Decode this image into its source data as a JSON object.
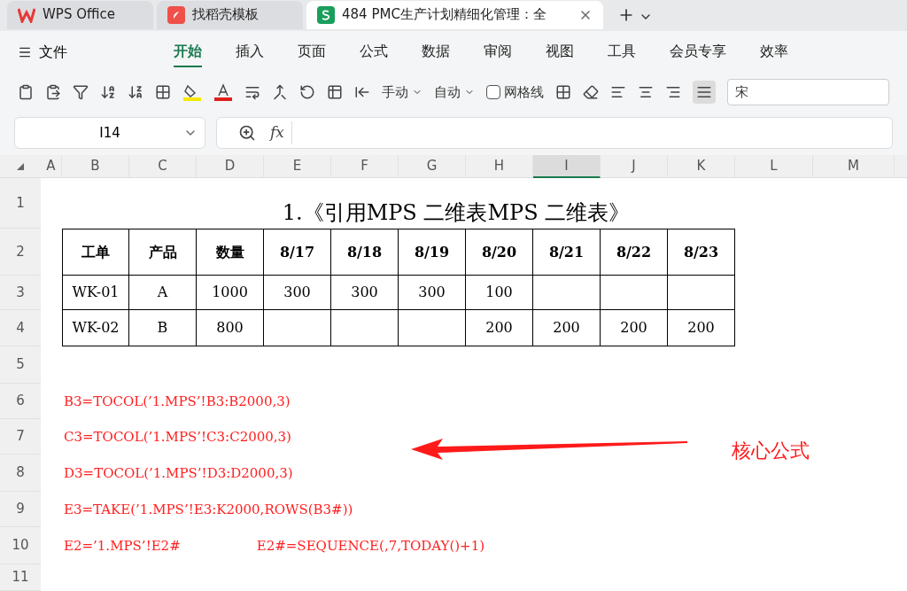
{
  "app_tabs": [
    {
      "label": "WPS Office",
      "kind": "wps",
      "selected": false
    },
    {
      "label": "找稻壳模板",
      "kind": "docer",
      "selected": false
    },
    {
      "label": "484 PMC生产计划精细化管理：全",
      "kind": "sheet",
      "selected": true
    }
  ],
  "file_menu": "文件",
  "ribbon_tabs": [
    {
      "label": "开始",
      "selected": true
    },
    {
      "label": "插入",
      "selected": false
    },
    {
      "label": "页面",
      "selected": false
    },
    {
      "label": "公式",
      "selected": false
    },
    {
      "label": "数据",
      "selected": false
    },
    {
      "label": "审阅",
      "selected": false
    },
    {
      "label": "视图",
      "selected": false
    },
    {
      "label": "工具",
      "selected": false
    },
    {
      "label": "会员专享",
      "selected": false
    },
    {
      "label": "效率",
      "selected": false
    }
  ],
  "toolbar": {
    "row_height": "手动",
    "col_width": "自动",
    "gridlines": {
      "label": "网格线",
      "checked": false
    },
    "font": "宋"
  },
  "name_box": "I14",
  "formula_label": "fx",
  "columns": [
    {
      "label": "A",
      "selected": false
    },
    {
      "label": "B",
      "selected": false
    },
    {
      "label": "C",
      "selected": false
    },
    {
      "label": "D",
      "selected": false
    },
    {
      "label": "E",
      "selected": false
    },
    {
      "label": "F",
      "selected": false
    },
    {
      "label": "G",
      "selected": false
    },
    {
      "label": "H",
      "selected": false
    },
    {
      "label": "I",
      "selected": true
    },
    {
      "label": "J",
      "selected": false
    },
    {
      "label": "K",
      "selected": false
    },
    {
      "label": "L",
      "selected": false
    },
    {
      "label": "M",
      "selected": false
    }
  ],
  "rows": [
    "1",
    "2",
    "3",
    "4",
    "5",
    "6",
    "7",
    "8",
    "9",
    "10",
    "11"
  ],
  "title": "1.《引用MPS 二维表MPS 二维表》",
  "table": {
    "header": [
      "工单",
      "产品",
      "数量",
      "8/17",
      "8/18",
      "8/19",
      "8/20",
      "8/21",
      "8/22",
      "8/23"
    ],
    "rows": [
      [
        "WK-01",
        "A",
        "1000",
        "300",
        "300",
        "300",
        "100",
        "",
        "",
        ""
      ],
      [
        "WK-02",
        "B",
        "800",
        "",
        "",
        "",
        "200",
        "200",
        "200",
        "200"
      ]
    ]
  },
  "formulas": [
    {
      "text": "B3=TOCOL(’1.MPS’!B3:B2000,3)"
    },
    {
      "text": "C3=TOCOL(’1.MPS’!C3:C2000,3)"
    },
    {
      "text": "D3=TOCOL(’1.MPS’!D3:D2000,3)"
    },
    {
      "text": "E3=TAKE(’1.MPS’!E3:K2000,ROWS(B3#))"
    },
    {
      "text": "E2=’1.MPS’!E2#",
      "extra": "E2#=SEQUENCE(,7,TODAY()+1)"
    }
  ],
  "annotation": "核心公式"
}
